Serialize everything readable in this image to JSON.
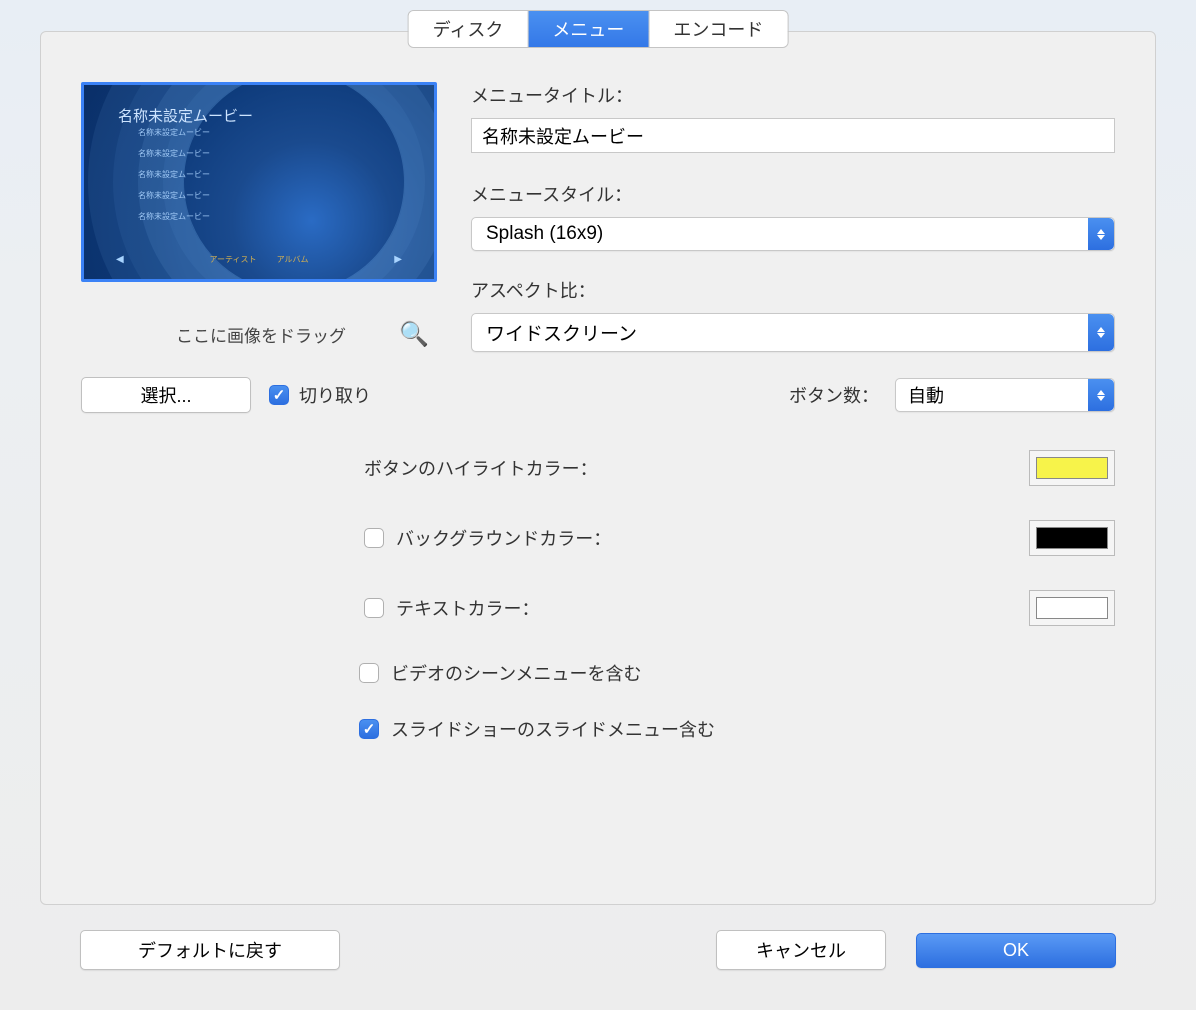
{
  "tabs": {
    "disc": "ディスク",
    "menu": "メニュー",
    "encode": "エンコード"
  },
  "preview": {
    "title": "名称未設定ムービー",
    "items": [
      "名称未設定ムービー",
      "名称未設定ムービー",
      "名称未設定ムービー",
      "名称未設定ムービー",
      "名称未設定ムービー"
    ],
    "nav": {
      "artist": "アーティスト",
      "album": "アルバム"
    }
  },
  "drag": {
    "text": "ここに画像をドラッグ",
    "select_button": "選択...",
    "crop_label": "切り取り"
  },
  "form": {
    "title_label": "メニュータイトル：",
    "title_value": "名称未設定ムービー",
    "style_label": "メニュースタイル：",
    "style_value": "Splash (16x9)",
    "aspect_label": "アスペクト比：",
    "aspect_value": "ワイドスクリーン",
    "button_count_label": "ボタン数：",
    "button_count_value": "自動",
    "highlight_label": "ボタンのハイライトカラー：",
    "background_label": "バックグラウンドカラー：",
    "text_color_label": "テキストカラー："
  },
  "colors": {
    "highlight": "#f7f34a",
    "background": "#000000",
    "text": "#ffffff"
  },
  "options": {
    "scene_menu": "ビデオのシーンメニューを含む",
    "slide_menu": "スライドショーのスライドメニュー含む"
  },
  "buttons": {
    "defaults": "デフォルトに戻す",
    "cancel": "キャンセル",
    "ok": "OK"
  }
}
